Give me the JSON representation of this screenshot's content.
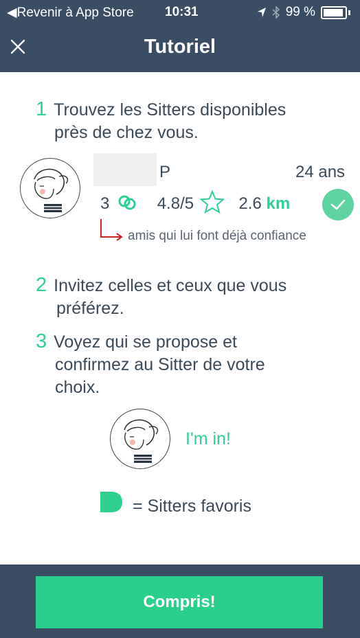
{
  "status_bar": {
    "back_label": "Revenir à App Store",
    "time": "10:31",
    "battery": "99 %"
  },
  "header": {
    "title": "Tutoriel"
  },
  "steps": [
    {
      "number": "1",
      "line1": "Trouvez les Sitters disponibles",
      "line2": "près de chez vous."
    },
    {
      "number": "2",
      "line1": "Invitez celles et ceux que vous",
      "line2": "préférez."
    },
    {
      "number": "3",
      "line1": "Voyez qui se propose et",
      "line2": "confirmez au Sitter de votre",
      "line3": "choix."
    }
  ],
  "sitter_card": {
    "name_initial": "P",
    "age": "24 ans",
    "friends_count": "3",
    "rating": "4.8/5",
    "distance": "2.6",
    "distance_unit": "km"
  },
  "annotation": "amis qui lui font déjà confiance",
  "im_in": "I'm in!",
  "favorites_label": "= Sitters favoris",
  "cta_label": "Compris!",
  "colors": {
    "accent": "#2fcf8f",
    "header": "#3b4d63",
    "annotation_arrow": "#cc2222"
  }
}
